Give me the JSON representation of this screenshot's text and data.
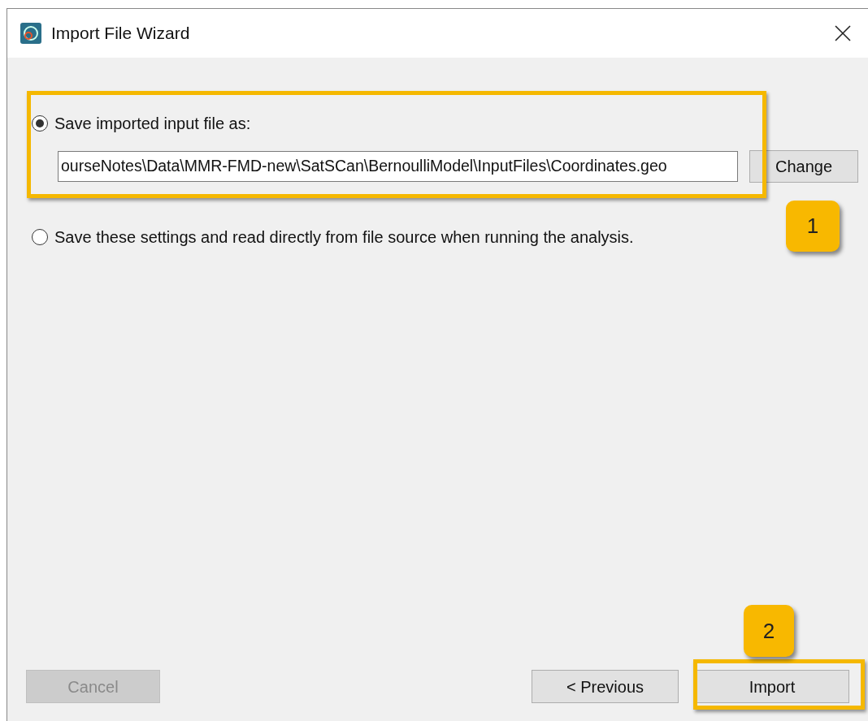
{
  "window": {
    "title": "Import File Wizard"
  },
  "options": [
    {
      "label": "Save imported input file as:",
      "selected": true
    },
    {
      "label": "Save these settings and read directly from file source when running the analysis.",
      "selected": false
    }
  ],
  "file_path": {
    "value": "ourseNotes\\Data\\MMR-FMD-new\\SatSCan\\BernoulliModel\\InputFiles\\Coordinates.geo"
  },
  "change_button": "Change",
  "buttons": [
    {
      "label": "Cancel",
      "disabled": true
    },
    {
      "label": "< Previous",
      "disabled": false
    },
    {
      "label": "Import",
      "disabled": false
    }
  ],
  "annotations": [
    {
      "label": "1"
    },
    {
      "label": "2"
    }
  ]
}
